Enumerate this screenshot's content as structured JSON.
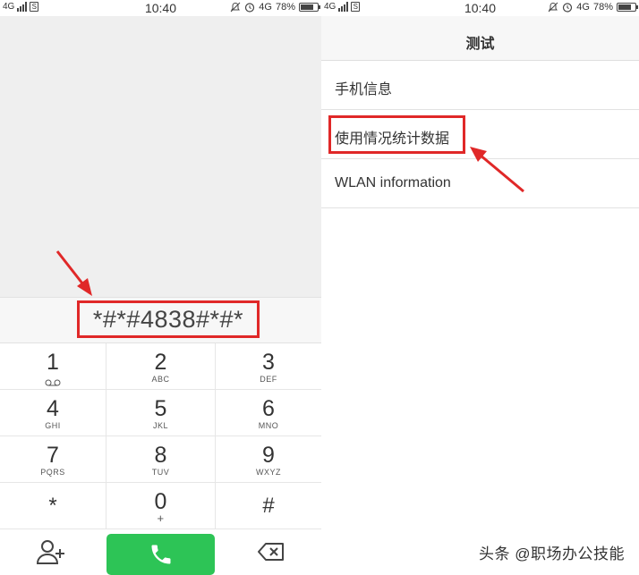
{
  "status_left": {
    "network": "4G",
    "sim_label": "S",
    "time": "10:40",
    "right_network": "4G",
    "battery": "78%",
    "battery_level": 0.78
  },
  "status_right": {
    "network": "4G",
    "sim_label": "S",
    "time": "10:40",
    "right_network": "4G",
    "battery": "78%",
    "battery_level": 0.78
  },
  "dialer": {
    "entered_number": "*#*#4838#*#*",
    "keys": [
      {
        "digit": "1",
        "letters": ""
      },
      {
        "digit": "2",
        "letters": "ABC"
      },
      {
        "digit": "3",
        "letters": "DEF"
      },
      {
        "digit": "4",
        "letters": "GHI"
      },
      {
        "digit": "5",
        "letters": "JKL"
      },
      {
        "digit": "6",
        "letters": "MNO"
      },
      {
        "digit": "7",
        "letters": "PQRS"
      },
      {
        "digit": "8",
        "letters": "TUV"
      },
      {
        "digit": "9",
        "letters": "WXYZ"
      },
      {
        "digit": "*",
        "letters": ""
      },
      {
        "digit": "0",
        "letters": "+"
      },
      {
        "digit": "#",
        "letters": ""
      }
    ]
  },
  "test_menu": {
    "title": "测试",
    "items": [
      {
        "label": "手机信息"
      },
      {
        "label": "使用情况统计数据"
      },
      {
        "label": "WLAN information"
      }
    ]
  },
  "watermark": "头条 @职场办公技能",
  "colors": {
    "highlight": "#e02828",
    "call_green": "#2dc456"
  }
}
